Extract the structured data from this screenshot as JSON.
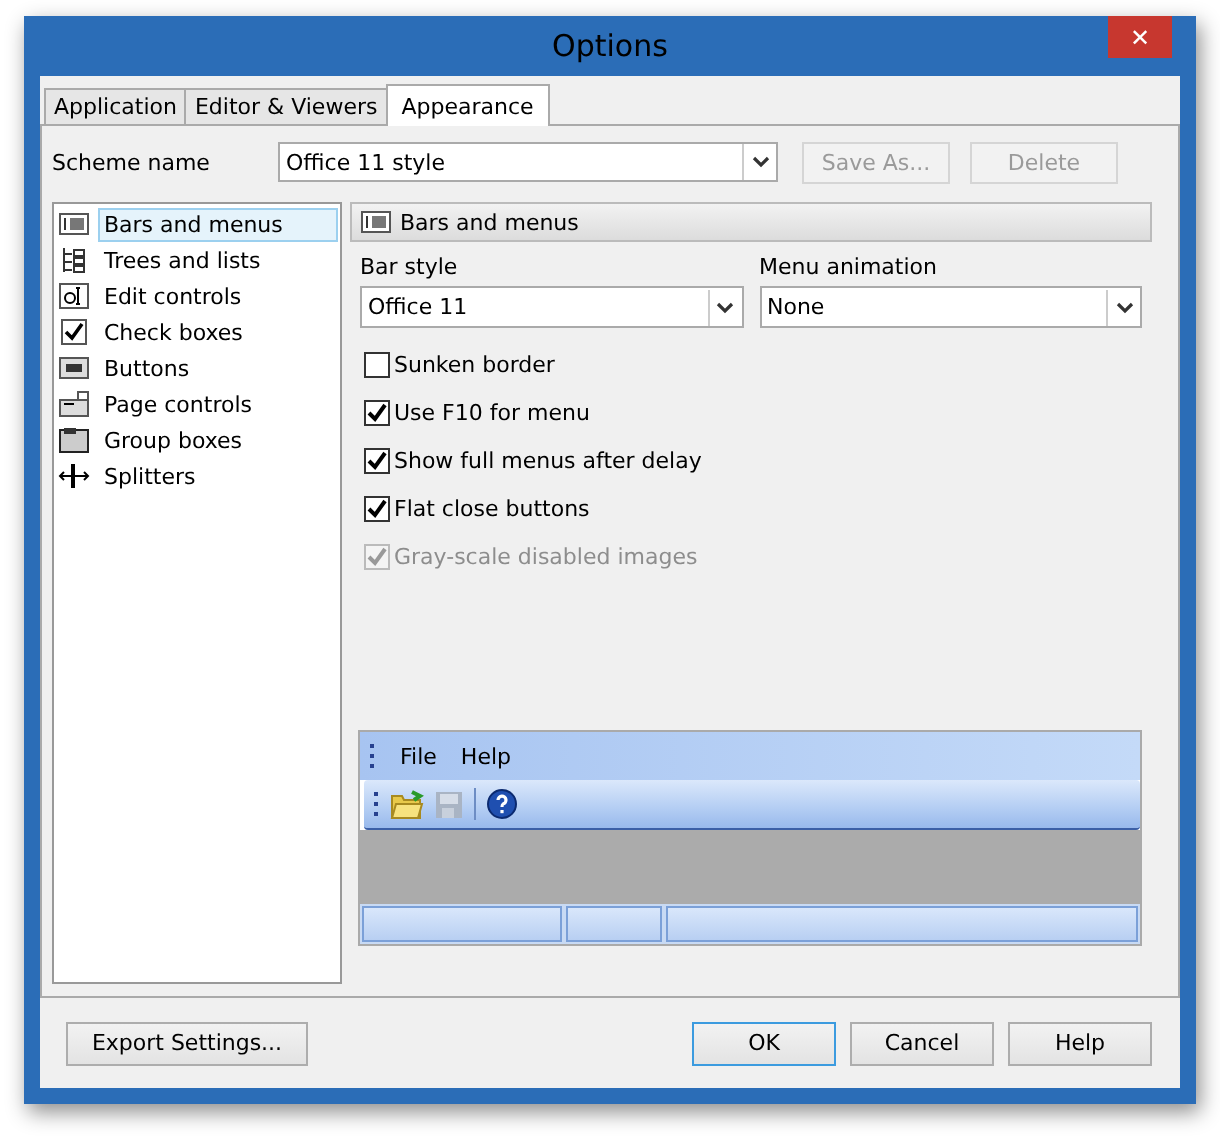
{
  "window": {
    "title": "Options",
    "close": "✕"
  },
  "tabs": [
    {
      "label": "Application",
      "selected": false
    },
    {
      "label": "Editor & Viewers",
      "selected": false
    },
    {
      "label": "Appearance",
      "selected": true
    }
  ],
  "scheme": {
    "label": "Scheme name",
    "value": "Office 11 style",
    "buttons": [
      {
        "label": "Save As...",
        "disabled": true
      },
      {
        "label": "Delete",
        "disabled": true
      }
    ]
  },
  "categories": [
    {
      "label": "Bars and menus",
      "selected": true
    },
    {
      "label": "Trees and lists",
      "selected": false
    },
    {
      "label": "Edit controls",
      "selected": false
    },
    {
      "label": "Check boxes",
      "selected": false
    },
    {
      "label": "Buttons",
      "selected": false
    },
    {
      "label": "Page controls",
      "selected": false
    },
    {
      "label": "Group boxes",
      "selected": false
    },
    {
      "label": "Splitters",
      "selected": false
    }
  ],
  "panel": {
    "title": "Bars and menus",
    "bar_style": {
      "label": "Bar style",
      "value": "Office 11"
    },
    "menu_animation": {
      "label": "Menu animation",
      "value": "None"
    },
    "options": [
      {
        "label": "Sunken border",
        "checked": false,
        "disabled": false
      },
      {
        "label": "Use F10 for menu",
        "checked": true,
        "disabled": false
      },
      {
        "label": "Show full menus after delay",
        "checked": true,
        "disabled": false
      },
      {
        "label": "Flat close buttons",
        "checked": true,
        "disabled": false
      },
      {
        "label": "Gray-scale disabled images",
        "checked": true,
        "disabled": true
      }
    ],
    "preview": {
      "menus": [
        "File",
        "Help"
      ]
    }
  },
  "footer": {
    "export": "Export Settings...",
    "buttons": [
      {
        "label": "OK",
        "default": true
      },
      {
        "label": "Cancel",
        "default": false
      },
      {
        "label": "Help",
        "default": false
      }
    ]
  }
}
